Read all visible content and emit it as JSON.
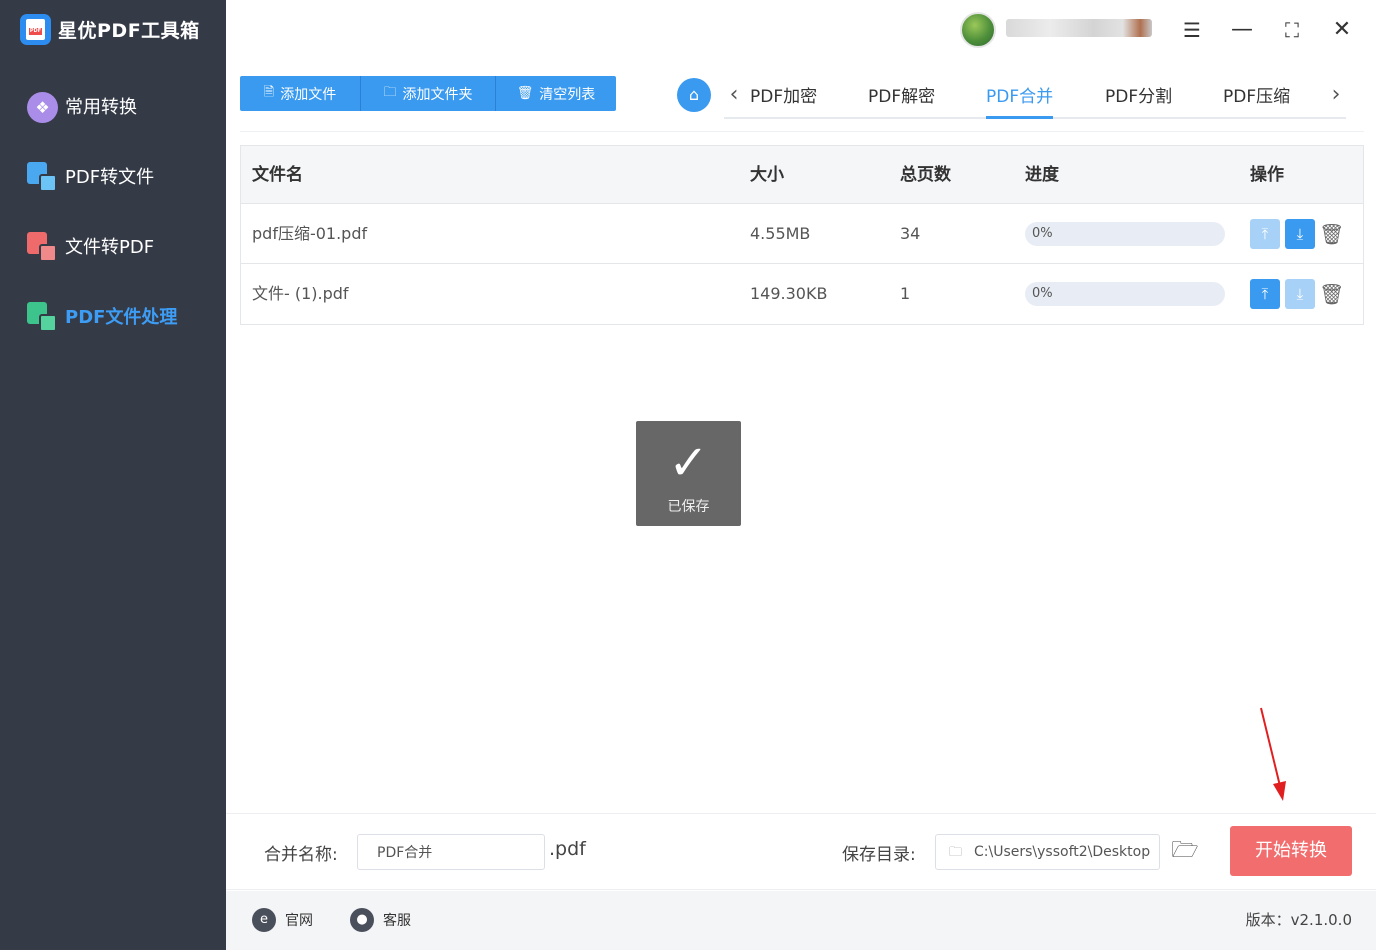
{
  "app": {
    "title": "星优PDF工具箱"
  },
  "sidebar": {
    "items": [
      {
        "label": "常用转换",
        "icon": "clover-icon"
      },
      {
        "label": "PDF转文件",
        "icon": "pdf-to-file-icon"
      },
      {
        "label": "文件转PDF",
        "icon": "file-to-pdf-icon"
      },
      {
        "label": "PDF文件处理",
        "icon": "pdf-process-icon",
        "active": true
      }
    ]
  },
  "window": {
    "settings_icon": "sliders-icon",
    "minimize_icon": "minimize-icon",
    "maximize_icon": "maximize-icon",
    "close_icon": "close-icon"
  },
  "toolbar": {
    "add_file": "添加文件",
    "add_folder": "添加文件夹",
    "clear_list": "清空列表"
  },
  "tabs": {
    "items": [
      "PDF加密",
      "PDF解密",
      "PDF合并",
      "PDF分割",
      "PDF压缩"
    ],
    "active": "PDF合并"
  },
  "table": {
    "headers": {
      "name": "文件名",
      "size": "大小",
      "pages": "总页数",
      "progress": "进度",
      "actions": "操作"
    },
    "rows": [
      {
        "name": "pdf压缩-01.pdf",
        "size": "4.55MB",
        "pages": "34",
        "progress": "0%",
        "progress_value": 0,
        "up_enabled": false,
        "down_enabled": true
      },
      {
        "name": "文件- (1).pdf",
        "size": "149.30KB",
        "pages": "1",
        "progress": "0%",
        "progress_value": 0,
        "up_enabled": true,
        "down_enabled": false
      }
    ]
  },
  "toast": {
    "text": "已保存"
  },
  "bottom": {
    "merge_name_label": "合并名称:",
    "merge_name_value": "PDF合并",
    "ext": ".pdf",
    "save_dir_label": "保存目录:",
    "save_dir_value": "C:\\Users\\yssoft2\\Desktop",
    "start_button": "开始转换"
  },
  "footer": {
    "website": "官网",
    "support": "客服",
    "version": "版本：v2.1.0.0"
  },
  "colors": {
    "accent": "#3a9af0",
    "sidebar_bg": "#353a47",
    "start_button": "#f26d6d",
    "annotation_arrow": "#e02020"
  }
}
